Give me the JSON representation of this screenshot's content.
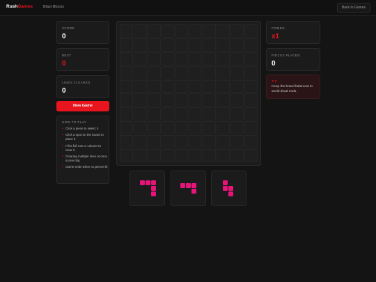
{
  "header": {
    "brand_part1": "Rush",
    "brand_part2": "Games",
    "game_title": "Blast Blocks",
    "back_label": "Back to Games"
  },
  "stats_left": {
    "score_label": "SCORE",
    "score_value": "0",
    "best_label": "BEST",
    "best_value": "0",
    "lines_label": "LINES CLEARED",
    "lines_value": "0"
  },
  "new_game_label": "New Game",
  "how_to_play": {
    "title": "HOW TO PLAY",
    "items": [
      "Click a piece to select it",
      "Click a spot on the board to place it",
      "Fill a full row or column to clear it",
      "Clearing multiple lines at once scores big",
      "Game ends when no pieces fit"
    ]
  },
  "stats_right": {
    "combo_label": "COMBO",
    "combo_value": "x1",
    "pieces_label": "PIECES PLACED",
    "pieces_value": "0"
  },
  "tip": {
    "label": "TIP",
    "text": "Keep the board balanced to avoid dead ends."
  },
  "board": {
    "rows": 10,
    "cols": 10
  },
  "pieces": [
    {
      "name": "piece-1",
      "cells": [
        [
          0,
          0
        ],
        [
          0,
          1
        ],
        [
          0,
          2
        ],
        [
          1,
          2
        ],
        [
          2,
          2
        ]
      ]
    },
    {
      "name": "piece-2",
      "cells": [
        [
          0,
          0
        ],
        [
          0,
          1
        ],
        [
          0,
          2
        ],
        [
          1,
          2
        ]
      ]
    },
    {
      "name": "piece-3",
      "cells": [
        [
          0,
          0
        ],
        [
          1,
          0
        ],
        [
          1,
          1
        ],
        [
          2,
          1
        ]
      ]
    }
  ],
  "colors": {
    "accent": "#e8141e",
    "piece": "#e8147a",
    "background": "#141414"
  }
}
